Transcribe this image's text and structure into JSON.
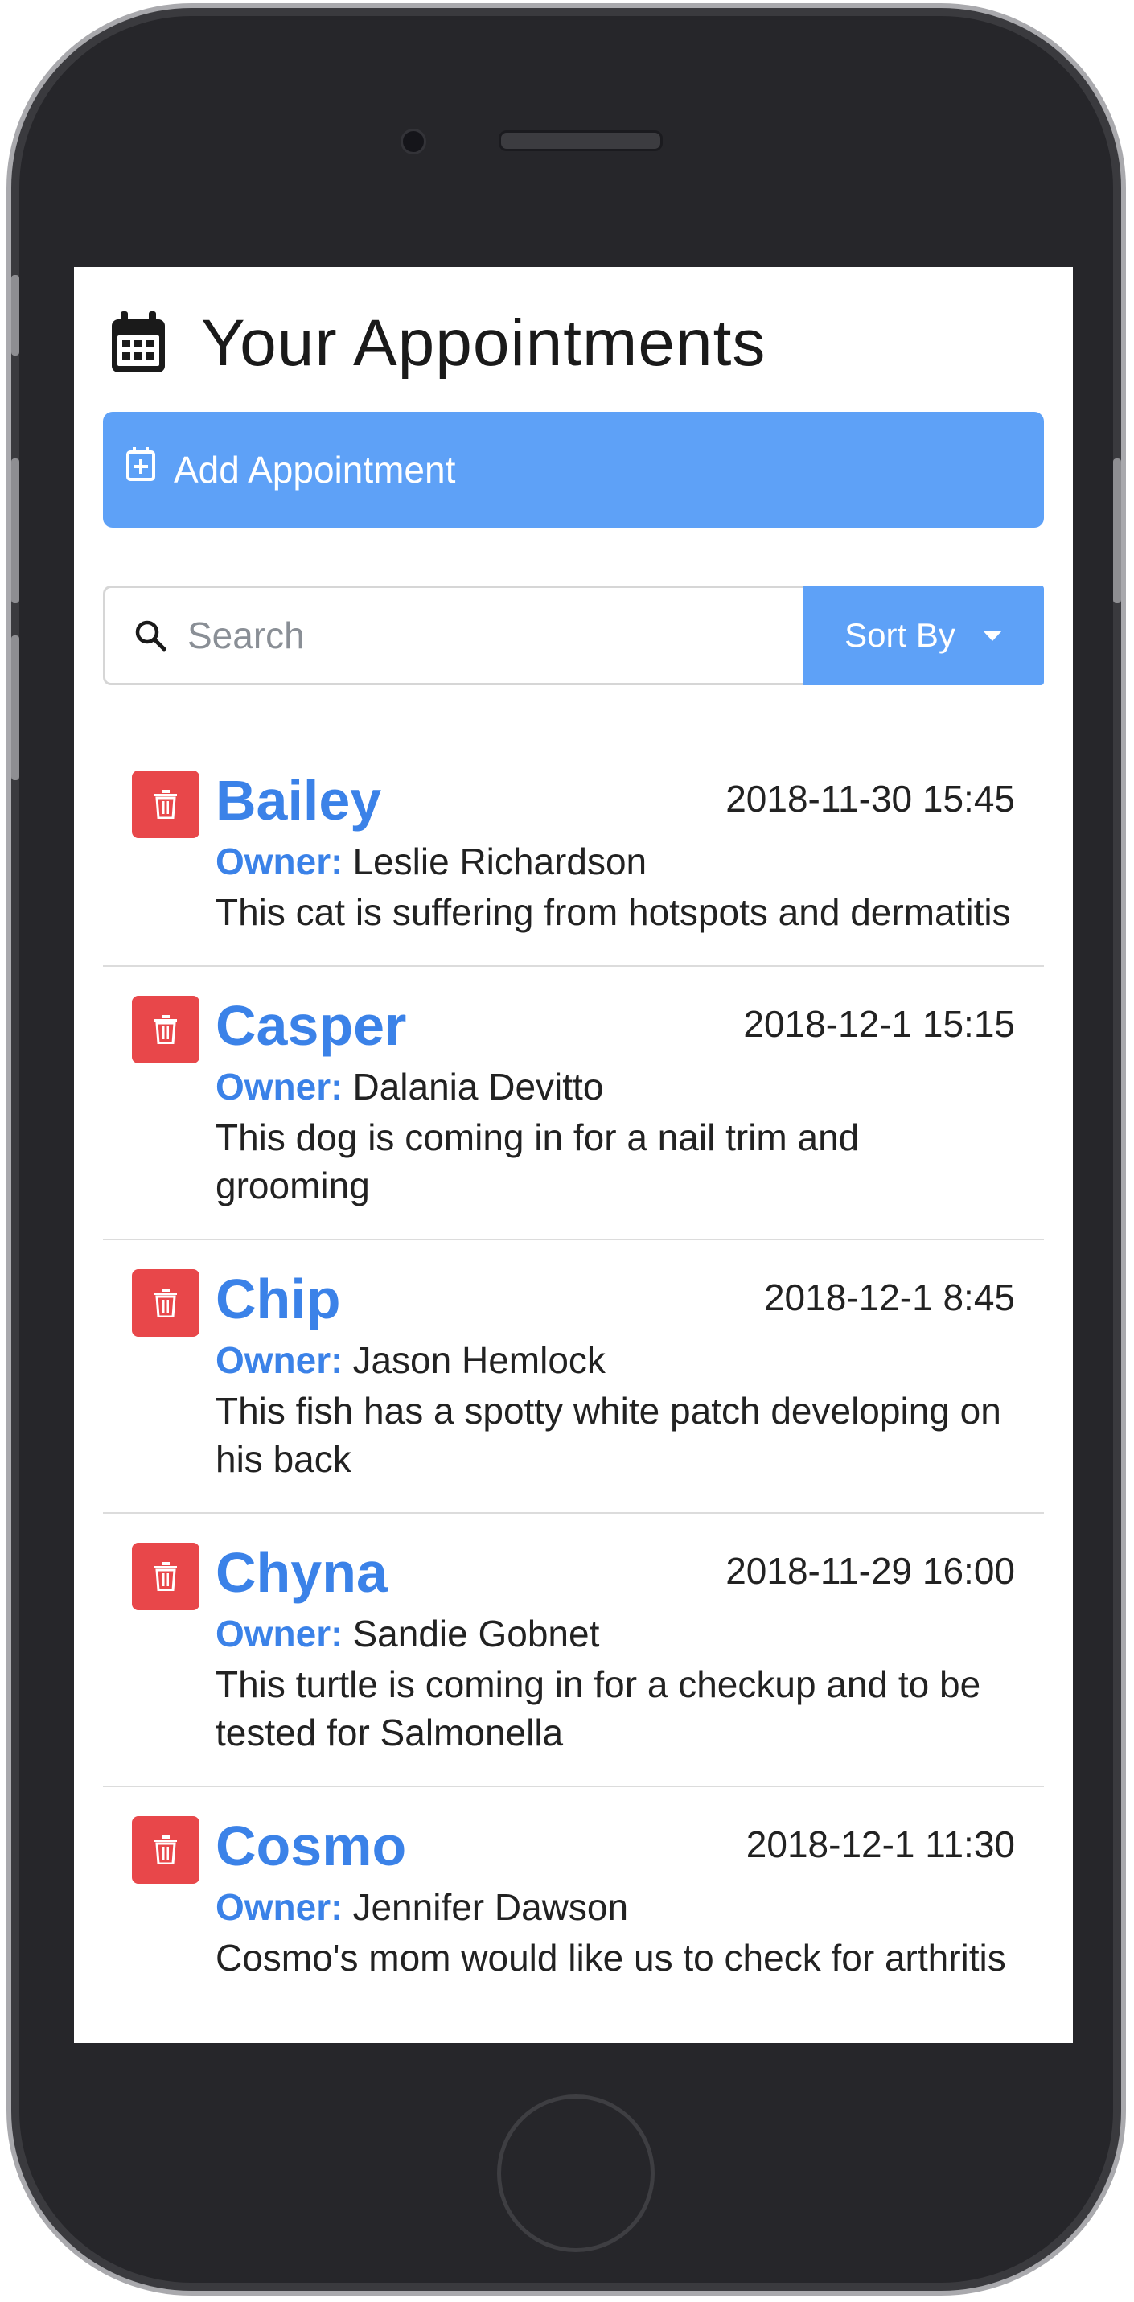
{
  "header": {
    "title": "Your Appointments",
    "icon": "calendar-icon"
  },
  "add_button": {
    "label": "Add Appointment",
    "icon": "calendar-plus-icon",
    "color": "#5ea1f7"
  },
  "search": {
    "placeholder": "Search",
    "icon": "search-icon"
  },
  "sort": {
    "label": "Sort By",
    "icon": "caret-down-icon"
  },
  "owner_label": "Owner:",
  "appointments": [
    {
      "pet": "Bailey",
      "date": "2018-11-30 15:45",
      "owner": "Leslie Richardson",
      "notes": "This cat is suffering from hotspots and dermatitis"
    },
    {
      "pet": "Casper",
      "date": "2018-12-1 15:15",
      "owner": "Dalania Devitto",
      "notes": "This dog is coming in for a nail trim and grooming"
    },
    {
      "pet": "Chip",
      "date": "2018-12-1 8:45",
      "owner": "Jason Hemlock",
      "notes": "This fish has a spotty white patch developing on his back"
    },
    {
      "pet": "Chyna",
      "date": "2018-11-29 16:00",
      "owner": "Sandie Gobnet",
      "notes": "This turtle is coming in for a checkup and to be tested for Salmonella"
    },
    {
      "pet": "Cosmo",
      "date": "2018-12-1 11:30",
      "owner": "Jennifer Dawson",
      "notes": "Cosmo's mom would like us to check for arthritis"
    }
  ],
  "colors": {
    "accent": "#3b82e8",
    "button": "#5ea1f7",
    "delete": "#e8474a"
  }
}
